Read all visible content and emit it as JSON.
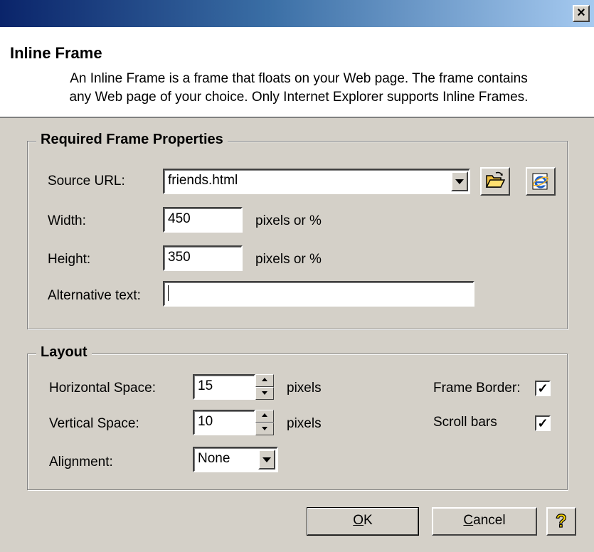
{
  "window": {
    "close_glyph": "×"
  },
  "header": {
    "title": "Inline Frame",
    "description_line1": "An Inline Frame is a frame that floats on your Web page.  The frame contains",
    "description_line2": "any Web page of your choice.  Only Internet Explorer supports Inline Frames."
  },
  "required": {
    "legend": "Required Frame Properties",
    "source_url": {
      "label": "Source URL:",
      "value": "friends.html"
    },
    "width": {
      "label": "Width:",
      "value": "450",
      "unit": "pixels or %"
    },
    "height": {
      "label": "Height:",
      "value": "350",
      "unit": "pixels or %"
    },
    "alt_text": {
      "label": "Alternative text:",
      "value": ""
    },
    "icons": [
      "folder-open-icon",
      "internet-explorer-icon"
    ]
  },
  "layout": {
    "legend": "Layout",
    "horizontal_space": {
      "label": "Horizontal Space:",
      "value": "15",
      "unit": "pixels"
    },
    "vertical_space": {
      "label": "Vertical Space:",
      "value": "10",
      "unit": "pixels"
    },
    "alignment": {
      "label": "Alignment:",
      "value": "None"
    },
    "frame_border": {
      "label": "Frame Border:",
      "checked": true
    },
    "scroll_bars": {
      "label": "Scroll bars",
      "checked": true
    }
  },
  "buttons": {
    "ok_mnemonic": "O",
    "ok_rest": "K",
    "cancel_mnemonic": "C",
    "cancel_rest": "ancel",
    "help_glyph": "?"
  },
  "colors": {
    "titlebar_start": "#0a246a",
    "titlebar_end": "#a6caf0",
    "dialog_face": "#d4d0c8",
    "help_yellow": "#ffd800"
  }
}
